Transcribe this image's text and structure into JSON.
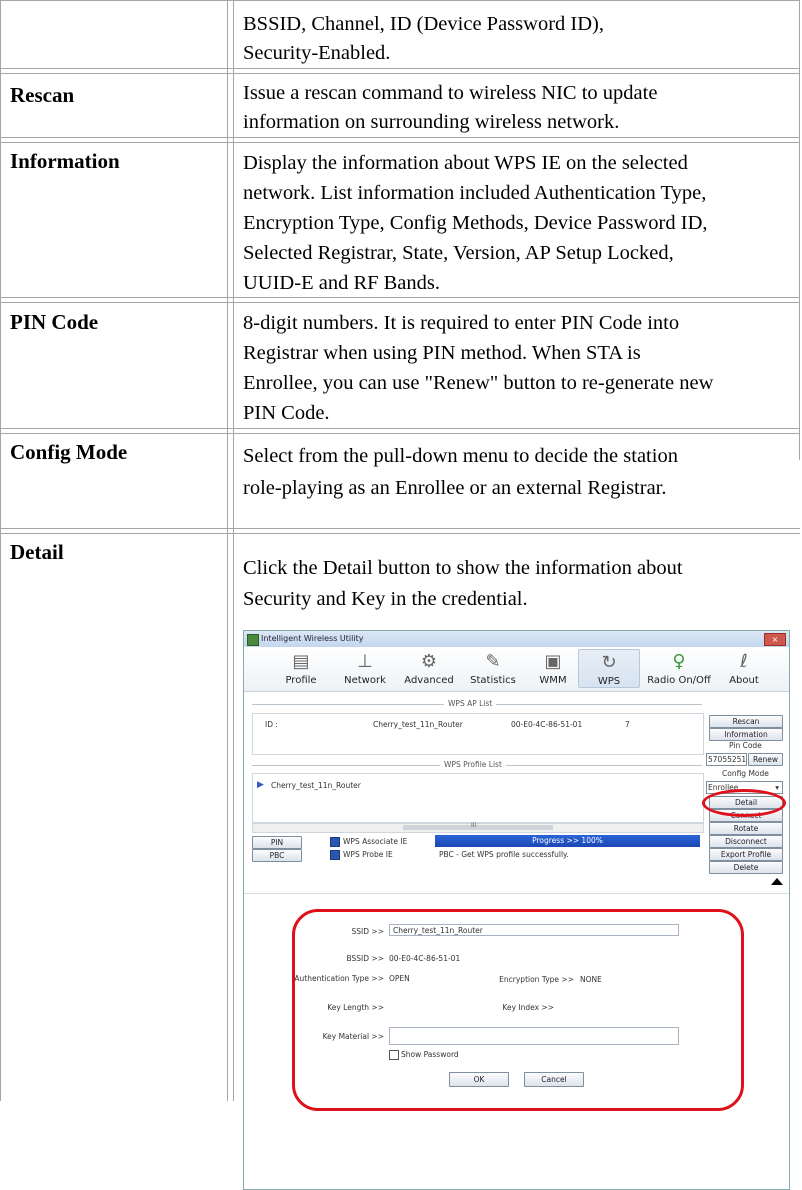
{
  "rows": [
    {
      "label": "",
      "text": [
        "BSSID, Channel, ID (Device Password ID),",
        "Security-Enabled."
      ]
    },
    {
      "label": "Rescan",
      "text": [
        "Issue a rescan command to wireless NIC to update",
        "information on surrounding wireless network."
      ]
    },
    {
      "label": "Information",
      "text": [
        "Display the information about WPS IE on the selected",
        "network. List information included Authentication Type,",
        "Encryption Type, Config Methods, Device Password ID,",
        "Selected Registrar, State, Version, AP Setup Locked,",
        "UUID-E and RF Bands."
      ]
    },
    {
      "label": "PIN Code",
      "text": [
        "8-digit numbers. It is required to enter PIN Code into",
        "Registrar when using PIN method. When STA is",
        "Enrollee, you can use \"Renew\" button to re-generate new",
        "PIN Code."
      ]
    },
    {
      "label": "Config Mode",
      "text": [
        "Select from the pull-down menu to decide the station",
        "role-playing as an Enrollee or an external Registrar."
      ]
    },
    {
      "label": "Detail",
      "text": [
        "Click the Detail button to show the information about",
        "Security and Key in the credential."
      ]
    }
  ],
  "app": {
    "title": "Intelligent Wireless Utility",
    "close": "×",
    "toolbar": [
      {
        "label": "Profile",
        "icon": "profile-icon"
      },
      {
        "label": "Network",
        "icon": "network-icon"
      },
      {
        "label": "Advanced",
        "icon": "advanced-icon"
      },
      {
        "label": "Statistics",
        "icon": "statistics-icon"
      },
      {
        "label": "WMM",
        "icon": "wmm-icon"
      },
      {
        "label": "WPS",
        "icon": "wps-icon",
        "active": true
      },
      {
        "label": "Radio On/Off",
        "icon": "radio-icon"
      },
      {
        "label": "About",
        "icon": "about-icon"
      }
    ],
    "wps_ap_list_title": "WPS AP List",
    "ap": {
      "id": "ID :",
      "ssid": "Cherry_test_11n_Router",
      "bssid": "00-E0-4C-86-51-01",
      "channel": "7"
    },
    "wps_profile_list_title": "WPS Profile List",
    "profile_item": "Cherry_test_11n_Router",
    "scroll_mark": "III",
    "buttons": {
      "rescan": "Rescan",
      "information": "Information",
      "pin_code_label": "Pin Code",
      "pin_value": "57055251",
      "renew": "Renew",
      "config_mode_label": "Config Mode",
      "config_mode_value": "Enrollee",
      "detail": "Detail",
      "connect": "Connect",
      "rotate": "Rotate",
      "disconnect": "Disconnect",
      "export_profile": "Export Profile",
      "delete": "Delete",
      "pin": "PIN",
      "pbc": "PBC"
    },
    "checks": {
      "associate": "WPS Associate IE",
      "probe": "WPS Probe IE"
    },
    "progress_text": "Progress >> 100%",
    "status_message": "PBC - Get WPS profile successfully.",
    "detail": {
      "ssid_label": "SSID >>",
      "ssid_value": "Cherry_test_11n_Router",
      "bssid_label": "BSSID >>",
      "bssid_value": "00-E0-4C-86-51-01",
      "auth_label": "Authentication Type >>",
      "auth_value": "OPEN",
      "enc_label": "Encryption Type >>",
      "enc_value": "NONE",
      "key_length_label": "Key Length >>",
      "key_index_label": "Key Index >>",
      "key_material_label": "Key Material >>",
      "show_password": "Show Password",
      "ok": "OK",
      "cancel": "Cancel"
    }
  },
  "colors": {
    "highlight": "#e0101a",
    "progress": "#1b47b3"
  }
}
